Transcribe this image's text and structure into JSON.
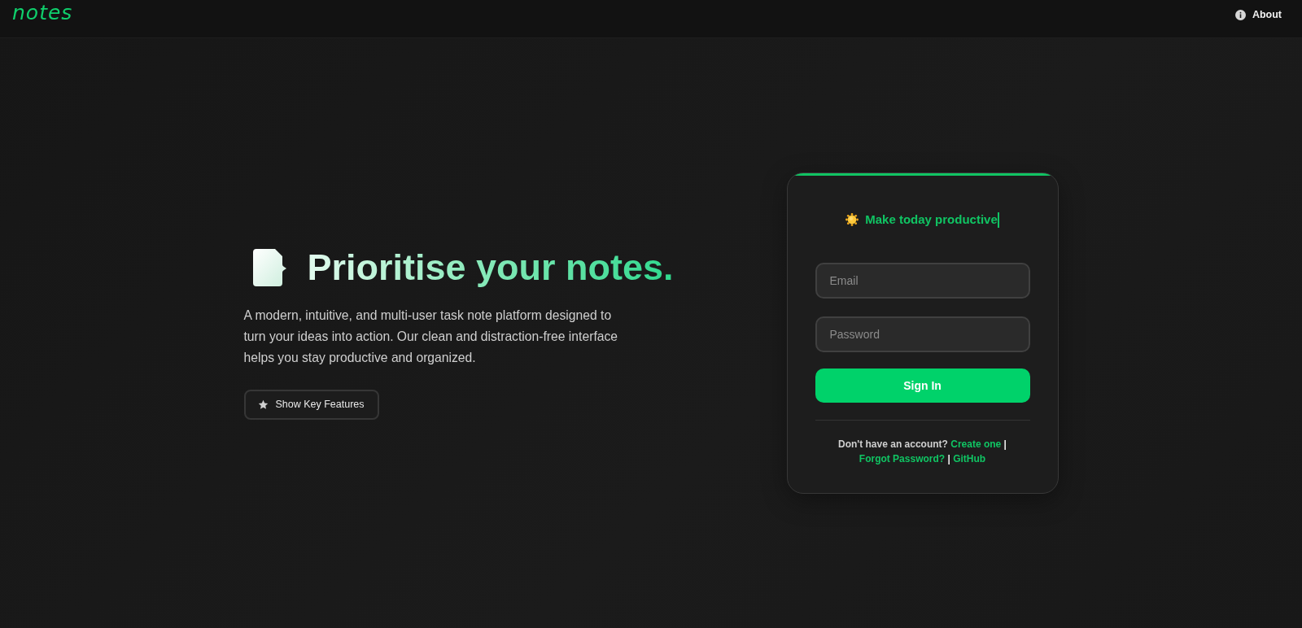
{
  "navbar": {
    "brand": "notes",
    "links": [
      {
        "label": "About"
      }
    ]
  },
  "hero": {
    "title": "Prioritise your notes.",
    "description": "A modern, intuitive, and multi-user task note platform designed to turn your ideas into action. Our clean and distraction-free interface helps you stay productive and organized.",
    "button": {
      "label": "Show Key Features"
    }
  },
  "login_card": {
    "tagline": "Make today productive",
    "fields": [
      {
        "placeholder": "Email"
      },
      {
        "placeholder": "Password"
      }
    ],
    "submit": "Sign In",
    "prompt": [
      {
        "kind": "text",
        "text": "Don't have an account?"
      },
      {
        "kind": "link",
        "text": "Create one"
      },
      {
        "kind": "separator",
        "text": "|"
      },
      {
        "kind": "link",
        "text": "Forgot Password?"
      },
      {
        "kind": "separator",
        "text": "|"
      },
      {
        "kind": "link",
        "text": "GitHub"
      }
    ]
  }
}
